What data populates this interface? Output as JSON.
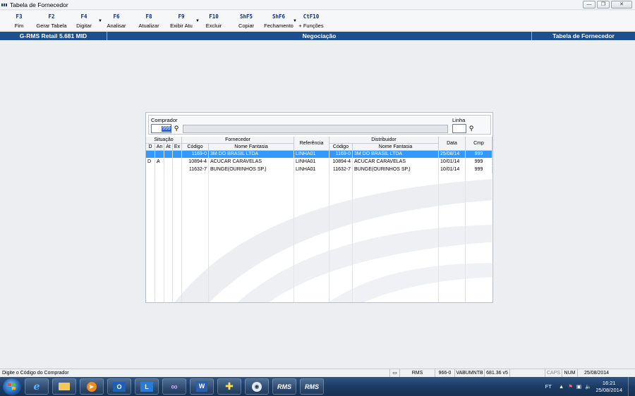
{
  "window": {
    "title": "Tabela de Fornecedor"
  },
  "toolbar": {
    "items": [
      {
        "key": "F3",
        "label": "Fim"
      },
      {
        "key": "F2",
        "label": "Gerar Tabela"
      },
      {
        "key": "F4",
        "label": "Digitar",
        "dropdown": true
      },
      {
        "key": "F6",
        "label": "Analisar"
      },
      {
        "key": "F8",
        "label": "Atualizar"
      },
      {
        "key": "F9",
        "label": "Exibir Atu",
        "dropdown": true
      },
      {
        "key": "F10",
        "label": "Excluir"
      },
      {
        "key": "ShF5",
        "label": "Copiar"
      },
      {
        "key": "ShF6",
        "label": "Fechamento",
        "dropdown": true
      },
      {
        "key": "CtF10",
        "label": "+ Funções"
      }
    ]
  },
  "header": {
    "left": "G-RMS Retail 5.681 MID",
    "center": "Negociação",
    "right": "Tabela de Fornecedor"
  },
  "filter": {
    "comprador_label": "Comprador",
    "comprador_value": "999",
    "linha_label": "Linha",
    "linha_value": ""
  },
  "grid": {
    "group_headers": {
      "situacao": "Situação",
      "fornecedor": "Fornecedor",
      "referencia": "Referência",
      "distribuidor": "Distribuidor",
      "data": "Data",
      "cmp": "Cmp"
    },
    "sub_headers": {
      "d": "D",
      "an": "An",
      "at": "At",
      "ex": "Ex",
      "codigo": "Código",
      "nome_fantasia": "Nome Fantasia",
      "dist_codigo": "Código",
      "dist_nome": "Nome Fantasia"
    },
    "rows": [
      {
        "d": "",
        "an": "",
        "at": "",
        "ex": "",
        "codigo": "1169-0",
        "nome": "3M DO BRASIL LTDA",
        "referencia": "LINHA01",
        "dist_codigo": "1169-0",
        "dist_nome": "3M DO BRASIL LTDA",
        "data": "25/08/14",
        "cmp": "999",
        "selected": true
      },
      {
        "d": "D",
        "an": "A",
        "at": "",
        "ex": "",
        "codigo": "10894-4",
        "nome": "ACUCAR CARAVELAS",
        "referencia": "LINHA01",
        "dist_codigo": "10894-4",
        "dist_nome": "ACUCAR CARAVELAS",
        "data": "10/01/14",
        "cmp": "999",
        "selected": false
      },
      {
        "d": "",
        "an": "",
        "at": "",
        "ex": "",
        "codigo": "11632-7",
        "nome": "BUNGE(OURINHOS SP.)",
        "referencia": "LINHA01",
        "dist_codigo": "11632-7",
        "dist_nome": "BUNGE(OURINHOS SP.)",
        "data": "10/01/14",
        "cmp": "999",
        "selected": false
      }
    ]
  },
  "statusbar": {
    "message": "Digite o Código do Comprador",
    "cells": [
      "RMS",
      "966-0",
      "VABUMNTB",
      "681.36 v5",
      "",
      "CAPS",
      "NUM",
      "25/08/2014"
    ]
  },
  "taskbar": {
    "apps": [
      "internet-explorer",
      "file-explorer",
      "media-player",
      "outlook",
      "lync",
      "app-infinity",
      "word",
      "calculator-app",
      "app-ie-alt",
      "rms-1",
      "rms-2"
    ],
    "rms_label": "RMS",
    "tray_lang": "FT",
    "time": "16:21",
    "date": "25/08/2014"
  },
  "colors": {
    "accent": "#1b4f8e",
    "selection": "#3399ff",
    "taskbar": "#1b3a63"
  }
}
